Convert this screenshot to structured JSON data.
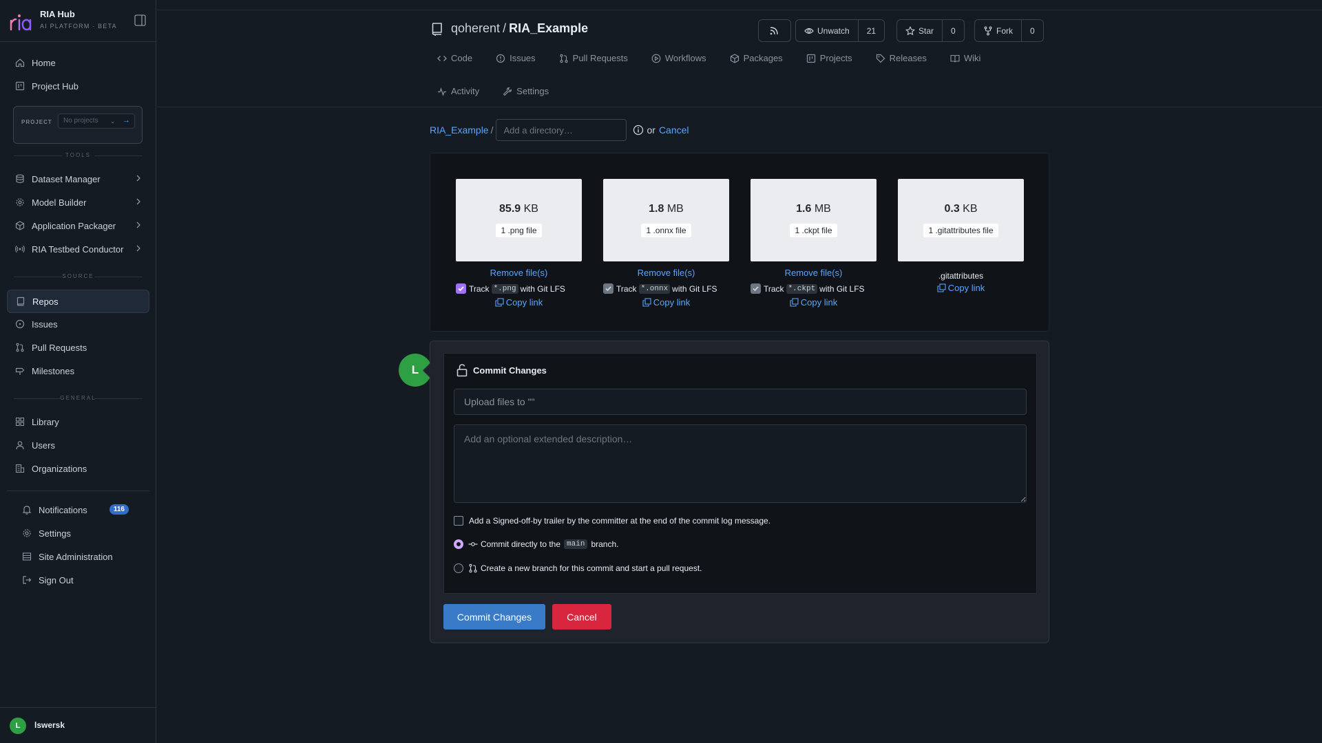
{
  "brand": {
    "title": "RIA Hub",
    "subtitle": "AI PLATFORM · BETA",
    "logo_text": "ria"
  },
  "sidebar": {
    "top_items": [
      {
        "label": "Home",
        "icon": "home-icon"
      },
      {
        "label": "Project Hub",
        "icon": "project-icon"
      }
    ],
    "project": {
      "label": "PROJECT",
      "placeholder": "No projects",
      "go": "→"
    },
    "sections": {
      "tools": "TOOLS",
      "source": "SOURCE",
      "general": "GENERAL"
    },
    "tools": [
      {
        "label": "Dataset Manager",
        "icon": "database-icon"
      },
      {
        "label": "Model Builder",
        "icon": "gear-icon"
      },
      {
        "label": "Application Packager",
        "icon": "package-icon"
      },
      {
        "label": "RIA Testbed Conductor",
        "icon": "broadcast-icon"
      }
    ],
    "source": [
      {
        "label": "Repos",
        "icon": "repo-icon",
        "active": true
      },
      {
        "label": "Issues",
        "icon": "issue-icon"
      },
      {
        "label": "Pull Requests",
        "icon": "pull-request-icon"
      },
      {
        "label": "Milestones",
        "icon": "milestone-icon"
      }
    ],
    "general": [
      {
        "label": "Library",
        "icon": "library-icon"
      },
      {
        "label": "Users",
        "icon": "user-icon"
      },
      {
        "label": "Organizations",
        "icon": "organization-icon"
      }
    ],
    "account": [
      {
        "label": "Notifications",
        "icon": "bell-icon",
        "badge": "116"
      },
      {
        "label": "Settings",
        "icon": "gear-icon"
      },
      {
        "label": "Site Administration",
        "icon": "server-icon"
      },
      {
        "label": "Sign Out",
        "icon": "sign-out-icon"
      }
    ],
    "user": {
      "initial": "L",
      "name": "lswersk"
    }
  },
  "repo": {
    "owner": "qoherent",
    "separator": "/",
    "name": "RIA_Example",
    "actions": {
      "watch_label": "Unwatch",
      "watch_count": "21",
      "star_label": "Star",
      "star_count": "0",
      "fork_label": "Fork",
      "fork_count": "0"
    },
    "tabs": [
      {
        "label": "Code",
        "icon": "code-icon"
      },
      {
        "label": "Issues",
        "icon": "issue-icon"
      },
      {
        "label": "Pull Requests",
        "icon": "pull-request-icon"
      },
      {
        "label": "Workflows",
        "icon": "play-icon"
      },
      {
        "label": "Packages",
        "icon": "package-icon"
      },
      {
        "label": "Projects",
        "icon": "project-icon"
      },
      {
        "label": "Releases",
        "icon": "tag-icon"
      },
      {
        "label": "Wiki",
        "icon": "book-icon"
      }
    ],
    "tabs2": [
      {
        "label": "Activity",
        "icon": "pulse-icon"
      },
      {
        "label": "Settings",
        "icon": "tool-icon"
      }
    ]
  },
  "upload": {
    "breadcrumb_root": "RIA_Example",
    "breadcrumb_sep": "/",
    "dir_placeholder": "Add a directory…",
    "or_text": "or",
    "cancel_link": "Cancel",
    "files": [
      {
        "size_num": "85.9",
        "size_unit": "KB",
        "count": "1 .png file",
        "remove": "Remove file(s)",
        "track_pre": "Track",
        "track_ext": "*.png",
        "track_post": "with Git LFS",
        "checked": true,
        "copy": "Copy link"
      },
      {
        "size_num": "1.8",
        "size_unit": "MB",
        "count": "1 .onnx file",
        "remove": "Remove file(s)",
        "track_pre": "Track",
        "track_ext": "*.onnx",
        "track_post": "with Git LFS",
        "checked": true,
        "copy": "Copy link"
      },
      {
        "size_num": "1.6",
        "size_unit": "MB",
        "count": "1 .ckpt file",
        "remove": "Remove file(s)",
        "track_pre": "Track",
        "track_ext": "*.ckpt",
        "track_post": "with Git LFS",
        "checked": true,
        "copy": "Copy link"
      },
      {
        "size_num": "0.3",
        "size_unit": "KB",
        "count": "1 .gitattributes file",
        "filename": ".gitattributes",
        "copy": "Copy link"
      }
    ]
  },
  "commit": {
    "avatar": "L",
    "title": "Commit Changes",
    "summary_placeholder": "Upload files to \"\"",
    "description_placeholder": "Add an optional extended description…",
    "signoff": "Add a Signed-off-by trailer by the committer at the end of the commit log message.",
    "direct_pre": "Commit directly to the",
    "branch": "main",
    "direct_post": "branch.",
    "new_branch": "Create a new branch for this commit and start a pull request.",
    "submit": "Commit Changes",
    "cancel": "Cancel"
  }
}
